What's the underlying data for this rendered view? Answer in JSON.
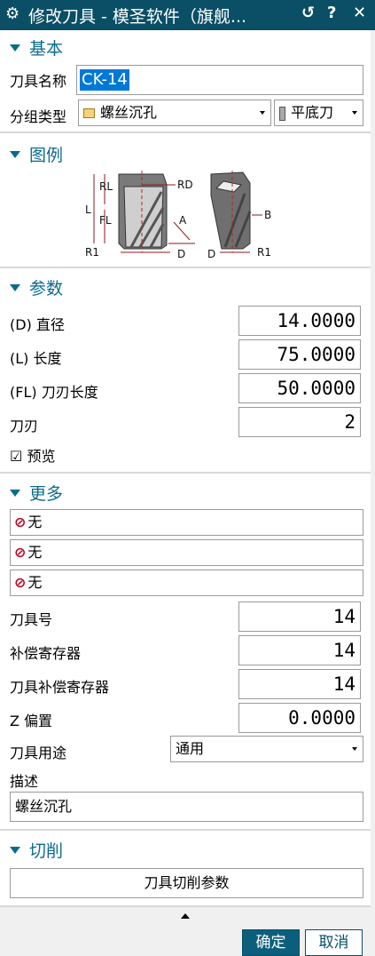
{
  "title": "修改刀具 - 模圣软件（旗舰...",
  "titlebar_icons": [
    "gear-icon",
    "refresh-icon",
    "help-icon",
    "close-icon"
  ],
  "titlebar_buttons": {
    "refresh": "↺",
    "help": "?",
    "close": "✕"
  },
  "basic": {
    "header": "基本",
    "tool_name_label": "刀具名称",
    "tool_name_value": "CK-14",
    "group_type_label": "分组类型",
    "group_value": "螺丝沉孔",
    "type_value": "平底刀"
  },
  "legend": {
    "header": "图例",
    "labels": {
      "RL": "RL",
      "RD": "RD",
      "L": "L",
      "FL": "FL",
      "A": "A",
      "R1": "R1",
      "D": "D",
      "B": "B",
      "D2": "D",
      "R1b": "R1"
    }
  },
  "params": {
    "header": "参数",
    "rows": [
      {
        "label": "(D) 直径",
        "value": "14.0000"
      },
      {
        "label": "(L) 长度",
        "value": "75.0000"
      },
      {
        "label": "(FL) 刀刃长度",
        "value": "50.0000"
      },
      {
        "label": "刀刃",
        "value": "2"
      }
    ],
    "preview_label": "预览",
    "preview_checked": true
  },
  "more": {
    "header": "更多",
    "none_items": [
      "无",
      "无",
      "无"
    ],
    "rows": [
      {
        "label": "刀具号",
        "value": "14"
      },
      {
        "label": "补偿寄存器",
        "value": "14"
      },
      {
        "label": "刀具补偿寄存器",
        "value": "14"
      },
      {
        "label": "Z 偏置",
        "value": "0.0000"
      }
    ],
    "usage_label": "刀具用途",
    "usage_value": "通用",
    "desc_label": "描述",
    "desc_value": "螺丝沉孔"
  },
  "cut": {
    "header": "切削",
    "button": "刀具切削参数"
  },
  "footer": {
    "ok": "确定",
    "cancel": "取消"
  },
  "colors": {
    "titlebar": "#0a4f66",
    "accent": "#0b6b8c",
    "selection": "#0078d7",
    "none_icon": "#c0001a"
  }
}
